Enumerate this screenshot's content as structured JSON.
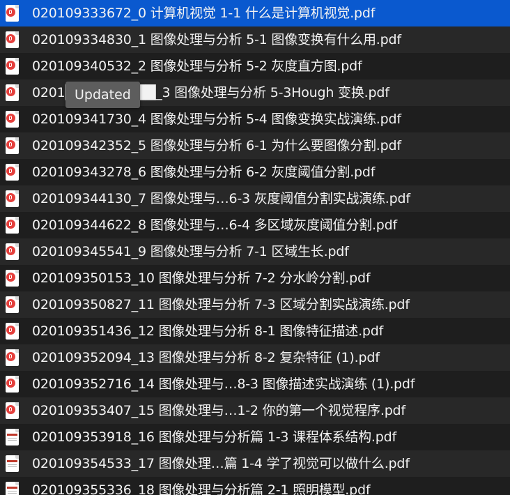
{
  "tooltip": "Updated",
  "files": [
    {
      "name": "020109333672_0 计算机视觉 1-1 什么是计算机视觉.pdf",
      "icon": "pdf-icon",
      "selected": true
    },
    {
      "name": "020109334830_1 图像处理与分析 5-1 图像变换有什么用.pdf",
      "icon": "pdf-icon"
    },
    {
      "name": "020109340532_2 图像处理与分析 5-2 灰度直方图.pdf",
      "icon": "pdf-icon"
    },
    {
      "name": "0201█████████_3 图像处理与分析 5-3Hough 变换.pdf",
      "icon": "pdf-icon"
    },
    {
      "name": "020109341730_4 图像处理与分析 5-4 图像变换实战演练.pdf",
      "icon": "pdf-icon"
    },
    {
      "name": "020109342352_5 图像处理与分析 6-1 为什么要图像分割.pdf",
      "icon": "pdf-icon"
    },
    {
      "name": "020109343278_6 图像处理与分析 6-2 灰度阈值分割.pdf",
      "icon": "pdf-icon"
    },
    {
      "name": "020109344130_7 图像处理与…6-3 灰度阈值分割实战演练.pdf",
      "icon": "pdf-icon"
    },
    {
      "name": "020109344622_8 图像处理与…6-4 多区域灰度阈值分割.pdf",
      "icon": "pdf-icon"
    },
    {
      "name": "020109345541_9 图像处理与分析 7-1 区域生长.pdf",
      "icon": "pdf-icon"
    },
    {
      "name": "020109350153_10 图像处理与分析 7-2 分水岭分割.pdf",
      "icon": "pdf-icon"
    },
    {
      "name": "020109350827_11 图像处理与分析 7-3 区域分割实战演练.pdf",
      "icon": "pdf-icon"
    },
    {
      "name": "020109351436_12 图像处理与分析 8-1 图像特征描述.pdf",
      "icon": "pdf-icon"
    },
    {
      "name": "020109352094_13 图像处理与分析 8-2 复杂特征 (1).pdf",
      "icon": "pdf-icon"
    },
    {
      "name": "020109352716_14 图像处理与…8-3 图像描述实战演练 (1).pdf",
      "icon": "pdf-icon"
    },
    {
      "name": "020109353407_15 图像处理与…1-2 你的第一个视觉程序.pdf",
      "icon": "pdf-icon"
    },
    {
      "name": "020109353918_16 图像处理与分析篇 1-3 课程体系结构.pdf",
      "icon": "document-icon"
    },
    {
      "name": "020109354533_17 图像处理…篇 1-4 学了视觉可以做什么.pdf",
      "icon": "document-icon"
    },
    {
      "name": "020109355336_18 图像处理与分析篇 2-1 照明模型.pdf",
      "icon": "document-icon"
    }
  ]
}
